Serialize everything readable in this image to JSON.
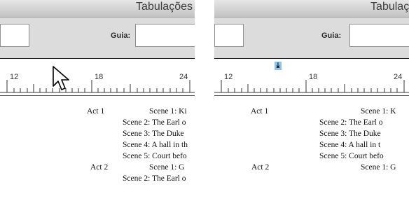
{
  "left": {
    "title": "Tabulações",
    "guia_label": "Guia:",
    "ruler_labels": [
      "12",
      "18",
      "24"
    ],
    "lines": [
      {
        "a": "Act 1",
        "b": "Scene 1: Ki"
      },
      {
        "b": "Scene 2: The Earl o"
      },
      {
        "b": "Scene 3: The Duke"
      },
      {
        "b": "Scene 4: A hall in th"
      },
      {
        "b": "Scene 5: Court befo"
      },
      {
        "a": "Act 2",
        "b": "Scene 1: G"
      },
      {
        "b": "Scene 2: The Earl o"
      }
    ]
  },
  "right": {
    "title": "Tabulações",
    "guia_label": "Guia:",
    "ruler_labels": [
      "12",
      "18",
      "24"
    ],
    "lines": [
      {
        "a": "Act 1",
        "b": "Scene 1: K"
      },
      {
        "b": "Scene 2: The Earl o"
      },
      {
        "b": "Scene 3: The Duke"
      },
      {
        "b": "Scene 4: A hall in t"
      },
      {
        "b": "Scene 5: Court befo"
      },
      {
        "a": "Act 2",
        "b": "Scene 1: G"
      }
    ]
  },
  "colors": {
    "tab_marker": "#8fc3ea"
  }
}
